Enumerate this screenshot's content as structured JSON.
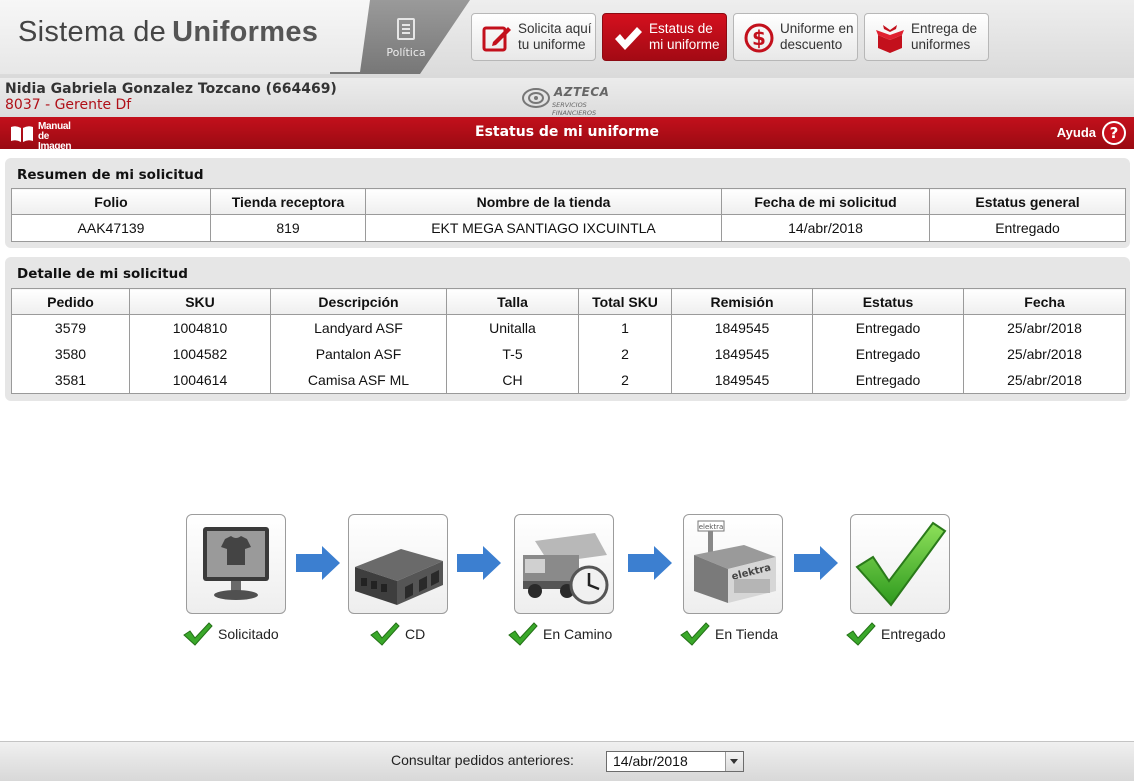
{
  "header": {
    "app_title_light": "Sistema de",
    "app_title_bold": "Uniformes",
    "politica_label": "Política",
    "nav": [
      {
        "label": "Solicita aquí\ntu uniforme",
        "icon": "edit-icon",
        "active": false
      },
      {
        "label": "Estatus de\nmi uniforme",
        "icon": "check-icon",
        "active": true
      },
      {
        "label": "Uniforme en\ndescuento",
        "icon": "dollar-icon",
        "active": false
      },
      {
        "label": "Entrega de\nuniformes",
        "icon": "gift-box-icon",
        "active": false
      }
    ]
  },
  "user": {
    "name": "Nidia Gabriela Gonzalez Tozcano (664469)",
    "role": "8037 - Gerente Df"
  },
  "logo": {
    "word": "AZTECA",
    "subtitle": "SERVICIOS FINANCIEROS"
  },
  "titlebar": {
    "manual_label": "Manual\nde Imagen",
    "title": "Estatus de mi uniforme",
    "help_label": "Ayuda",
    "help_icon_text": "?"
  },
  "summary": {
    "title": "Resumen de mi solicitud",
    "headers": [
      "Folio",
      "Tienda receptora",
      "Nombre de la tienda",
      "Fecha de mi solicitud",
      "Estatus general"
    ],
    "row": [
      "AAK47139",
      "819",
      "EKT MEGA SANTIAGO IXCUINTLA",
      "14/abr/2018",
      "Entregado"
    ]
  },
  "detail": {
    "title": "Detalle de mi solicitud",
    "headers": [
      "Pedido",
      "SKU",
      "Descripción",
      "Talla",
      "Total SKU",
      "Remisión",
      "Estatus",
      "Fecha"
    ],
    "rows": [
      [
        "3579",
        "1004810",
        "Landyard ASF",
        "Unitalla",
        "1",
        "1849545",
        "Entregado",
        "25/abr/2018"
      ],
      [
        "3580",
        "1004582",
        "Pantalon ASF",
        "T-5",
        "2",
        "1849545",
        "Entregado",
        "25/abr/2018"
      ],
      [
        "3581",
        "1004614",
        "Camisa ASF ML",
        "CH",
        "2",
        "1849545",
        "Entregado",
        "25/abr/2018"
      ]
    ]
  },
  "tracking": {
    "steps": [
      {
        "label": "Solicitado",
        "icon": "monitor-shirt-icon",
        "done": true
      },
      {
        "label": "CD",
        "icon": "warehouse-icon",
        "done": true
      },
      {
        "label": "En Camino",
        "icon": "truck-clock-icon",
        "done": true
      },
      {
        "label": "En Tienda",
        "icon": "elektra-store-icon",
        "done": true
      },
      {
        "label": "Entregado",
        "icon": "big-checkmark-icon",
        "done": true
      }
    ],
    "store_sign_text": "elektra"
  },
  "footer": {
    "consult_label": "Consultar pedidos anteriores:",
    "selected_date": "14/abr/2018"
  },
  "colors": {
    "brand_red": "#c3101c",
    "arrow_blue": "#3c7fd0",
    "check_green": "#3aa82a"
  }
}
